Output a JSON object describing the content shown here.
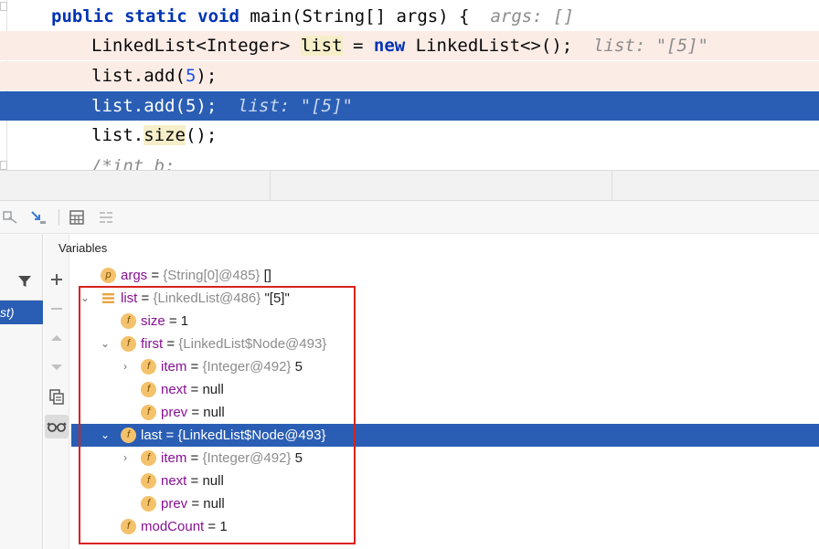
{
  "editor": {
    "lines": [
      {
        "segments": [
          {
            "t": "public static void ",
            "c": "kw"
          },
          {
            "t": "main(String[] args) {  ",
            "c": ""
          },
          {
            "t": "args: []",
            "c": "inline-hint"
          }
        ]
      },
      {
        "segments": [
          {
            "t": "LinkedList<Integer> ",
            "c": ""
          },
          {
            "t": "list",
            "c": "var-hl"
          },
          {
            "t": " = ",
            "c": ""
          },
          {
            "t": "new",
            "c": "kw"
          },
          {
            "t": " LinkedList<>();  ",
            "c": ""
          },
          {
            "t": "list: \"[5]\"",
            "c": "inline-hint"
          }
        ]
      },
      {
        "segments": [
          {
            "t": "list.add(",
            "c": ""
          },
          {
            "t": "5",
            "c": "num"
          },
          {
            "t": ");",
            "c": ""
          }
        ]
      },
      {
        "segments": [
          {
            "t": "list.add(",
            "c": ""
          },
          {
            "t": "5",
            "c": "num"
          },
          {
            "t": ");  ",
            "c": ""
          },
          {
            "t": "list: \"[5]\"",
            "c": "inline-hint"
          }
        ]
      },
      {
        "segments": [
          {
            "t": "list.",
            "c": ""
          },
          {
            "t": "size",
            "c": "method-hl"
          },
          {
            "t": "();",
            "c": ""
          }
        ]
      },
      {
        "segments": [
          {
            "t": "/*int b;",
            "c": "comment"
          }
        ]
      }
    ]
  },
  "frames": {
    "selected_label": "st)"
  },
  "variables": {
    "header": "Variables",
    "rows": [
      {
        "arrow": "",
        "badge": "p",
        "name": "args",
        "type": "{String[0]@485}",
        "value": "[]"
      },
      {
        "arrow": "⌄",
        "badge": "list",
        "name": "list",
        "type": "{LinkedList@486}",
        "value": "\"[5]\""
      },
      {
        "arrow": "",
        "badge": "f",
        "name": "size",
        "type": "",
        "value": "1"
      },
      {
        "arrow": "⌄",
        "badge": "f",
        "name": "first",
        "type": "{LinkedList$Node@493}",
        "value": ""
      },
      {
        "arrow": "›",
        "badge": "f",
        "name": "item",
        "type": "{Integer@492}",
        "value": "5"
      },
      {
        "arrow": "",
        "badge": "f",
        "name": "next",
        "type": "",
        "value": "null"
      },
      {
        "arrow": "",
        "badge": "f",
        "name": "prev",
        "type": "",
        "value": "null"
      },
      {
        "arrow": "⌄",
        "badge": "f",
        "name": "last",
        "type": "{LinkedList$Node@493}",
        "value": ""
      },
      {
        "arrow": "›",
        "badge": "f",
        "name": "item",
        "type": "{Integer@492}",
        "value": "5"
      },
      {
        "arrow": "",
        "badge": "f",
        "name": "next",
        "type": "",
        "value": "null"
      },
      {
        "arrow": "",
        "badge": "f",
        "name": "prev",
        "type": "",
        "value": "null"
      },
      {
        "arrow": "",
        "badge": "f",
        "name": "modCount",
        "type": "",
        "value": "1"
      }
    ]
  },
  "colors": {
    "selection": "#2a5eb4",
    "exec_line_bg": "#fbece6",
    "annotation_box": "#d9221c",
    "field_badge": "#f4c26c"
  }
}
